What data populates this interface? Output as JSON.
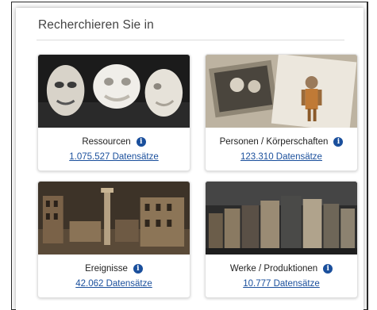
{
  "panel": {
    "title": "Recherchieren Sie in"
  },
  "cards": [
    {
      "label": "Ressourcen",
      "count": "1.075.527 Datensätze",
      "icon": "info-icon"
    },
    {
      "label": "Personen / Körperschaften",
      "count": "123.310 Datensätze",
      "icon": "info-icon"
    },
    {
      "label": "Ereignisse",
      "count": "42.062 Datensätze",
      "icon": "info-icon"
    },
    {
      "label": "Werke / Produktionen",
      "count": "10.777 Datensätze",
      "icon": "info-icon"
    }
  ],
  "colors": {
    "link": "#1a4f9c",
    "info_icon": "#1a4f9c",
    "panel_border": "#dcdcdc"
  }
}
